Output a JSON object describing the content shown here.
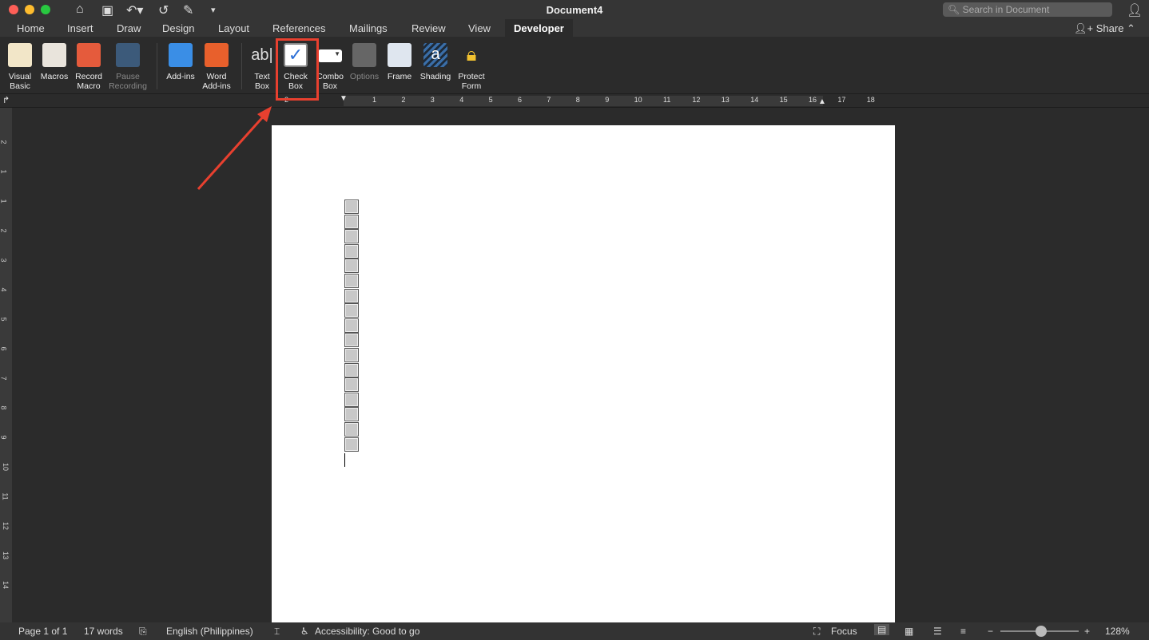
{
  "window": {
    "title": "Document4",
    "search_placeholder": "Search in Document",
    "share": "Share"
  },
  "tabs": [
    "Home",
    "Insert",
    "Draw",
    "Design",
    "Layout",
    "References",
    "Mailings",
    "Review",
    "View",
    "Developer"
  ],
  "active_tab": "Developer",
  "ribbon": [
    {
      "l1": "Visual",
      "l2": "Basic",
      "icon": "visual-basic-icon"
    },
    {
      "l1": "Macros",
      "l2": "",
      "icon": "macros-icon"
    },
    {
      "l1": "Record",
      "l2": "Macro",
      "icon": "record-macro-icon"
    },
    {
      "l1": "Pause",
      "l2": "Recording",
      "icon": "pause-recording-icon",
      "disabled": true
    },
    {
      "l1": "Add-ins",
      "l2": "",
      "icon": "add-ins-icon"
    },
    {
      "l1": "Word",
      "l2": "Add-ins",
      "icon": "word-add-ins-icon"
    },
    {
      "l1": "Text",
      "l2": "Box",
      "icon": "text-box-icon"
    },
    {
      "l1": "Check",
      "l2": "Box",
      "icon": "check-box-icon"
    },
    {
      "l1": "Combo",
      "l2": "Box",
      "icon": "combo-box-icon"
    },
    {
      "l1": "Options",
      "l2": "",
      "icon": "options-icon",
      "disabled": true
    },
    {
      "l1": "Frame",
      "l2": "",
      "icon": "frame-icon"
    },
    {
      "l1": "Shading",
      "l2": "",
      "icon": "shading-icon"
    },
    {
      "l1": "Protect",
      "l2": "Form",
      "icon": "protect-form-icon"
    }
  ],
  "ruler": [
    "2",
    "1",
    "2",
    "3",
    "4",
    "5",
    "6",
    "7",
    "8",
    "9",
    "10",
    "11",
    "12",
    "13",
    "14",
    "15",
    "16",
    "17",
    "18"
  ],
  "vruler": [
    "2",
    "1",
    "1",
    "2",
    "3",
    "4",
    "5",
    "6",
    "7",
    "8",
    "9",
    "10",
    "11",
    "12",
    "13",
    "14"
  ],
  "document": {
    "checkbox_count": 17
  },
  "status": {
    "page": "Page 1 of 1",
    "words": "17 words",
    "language": "English (Philippines)",
    "accessibility": "Accessibility: Good to go",
    "focus": "Focus",
    "zoom": "128%",
    "zoom_level_percent": 128
  },
  "colors": {
    "highlight": "#e8402f"
  }
}
